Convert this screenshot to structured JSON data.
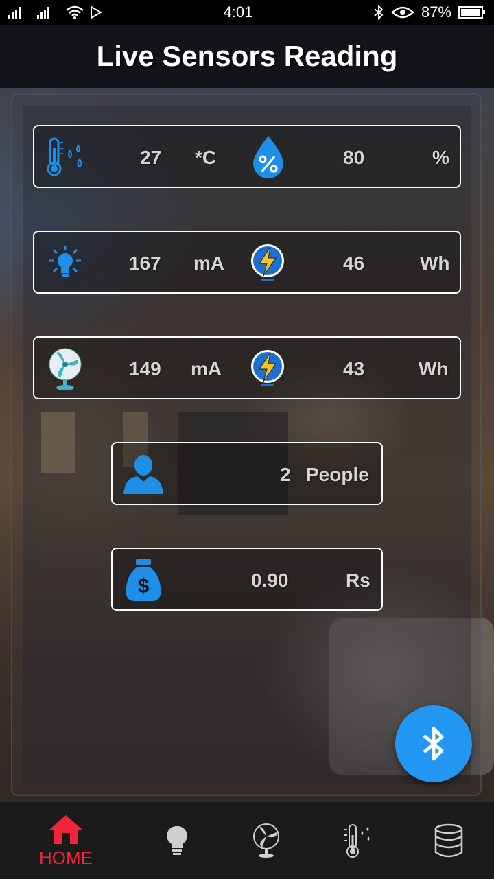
{
  "status_bar": {
    "time": "4:01",
    "battery": "87%"
  },
  "header": {
    "title": "Live Sensors Reading"
  },
  "rows": {
    "climate": {
      "temperature_value": "27",
      "temperature_unit": "*C",
      "humidity_value": "80",
      "humidity_unit": "%"
    },
    "light": {
      "current_value": "167",
      "current_unit": "mA",
      "energy_value": "46",
      "energy_unit": "Wh"
    },
    "fan": {
      "current_value": "149",
      "current_unit": "mA",
      "energy_value": "43",
      "energy_unit": "Wh"
    },
    "people": {
      "count": "2",
      "label": "People"
    },
    "cost": {
      "value": "0.90",
      "unit": "Rs"
    }
  },
  "bottom_nav": {
    "home_label": "HOME",
    "active_color": "#f0243a",
    "items": [
      "home-icon",
      "bulb-icon",
      "fan-icon",
      "thermometer-icon",
      "database-icon"
    ]
  },
  "colors": {
    "accent_blue": "#2196f3",
    "icon_blue": "#1e8fe8"
  }
}
